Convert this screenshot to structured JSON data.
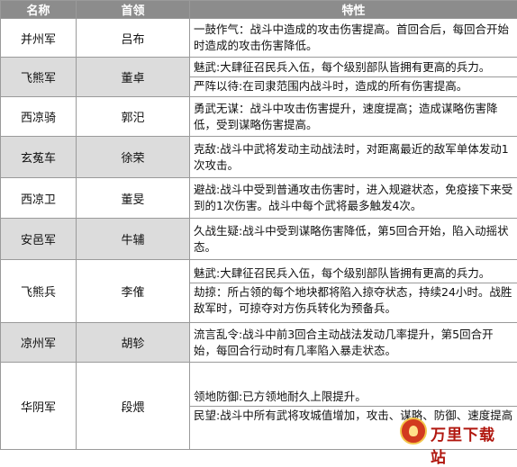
{
  "header": {
    "col_name": "名称",
    "col_leader": "首领",
    "col_trait": "特性"
  },
  "rows": [
    {
      "name": "并州军",
      "leader": "吕布",
      "traits": [
        "一鼓作气：战斗中造成的攻击伤害提高。首回合后，每回合开始时造成的攻击伤害降低。"
      ]
    },
    {
      "name": "飞熊军",
      "leader": "董卓",
      "traits": [
        "魅武:大肆征召民兵入伍，每个级别部队皆拥有更高的兵力。",
        "严阵以待:在司隶范围内战斗时，造成的所有伤害提高。"
      ]
    },
    {
      "name": "西凉骑",
      "leader": "郭汜",
      "traits": [
        "勇武无谋：战斗中攻击伤害提升，速度提高；造成谋略伤害降低，受到谋略伤害提高。"
      ]
    },
    {
      "name": "玄菟车",
      "leader": "徐荣",
      "traits": [
        "克敌:战斗中武将发动主动战法时，对距离最近的敌军单体发动1次攻击。"
      ]
    },
    {
      "name": "西凉卫",
      "leader": "董旻",
      "traits": [
        "避战:战斗中受到普通攻击伤害时，进入规避状态，免疫接下来受到的1次伤害。战斗中每个武将最多触发4次。"
      ]
    },
    {
      "name": "安邑军",
      "leader": "牛辅",
      "traits": [
        "久战生疑:战斗中受到谋略伤害降低，第5回合开始，陷入动摇状态。"
      ]
    },
    {
      "name": "飞熊兵",
      "leader": "李傕",
      "traits": [
        "魅武:大肆征召民兵入伍，每个级别部队皆拥有更高的兵力。",
        "劫掠：所占领的每个地块都将陷入掠夺状态，持续24小时。战胜敌军时，可掠夺对方伤兵转化为预备兵。"
      ]
    },
    {
      "name": "凉州军",
      "leader": "胡轸",
      "traits": [
        "流言乱令:战斗中前3回合主动战法发动几率提升，第5回合开始，每回合行动时有几率陷入暴走状态。"
      ]
    },
    {
      "name": "华阴军",
      "leader": "段煨",
      "traits": [
        "领地防御:已方领地耐久上限提升。",
        "民望:战斗中所有武将攻城值增加，攻击、谋略、防御、速度提高"
      ]
    }
  ],
  "watermark": {
    "text": "万里下载站"
  }
}
